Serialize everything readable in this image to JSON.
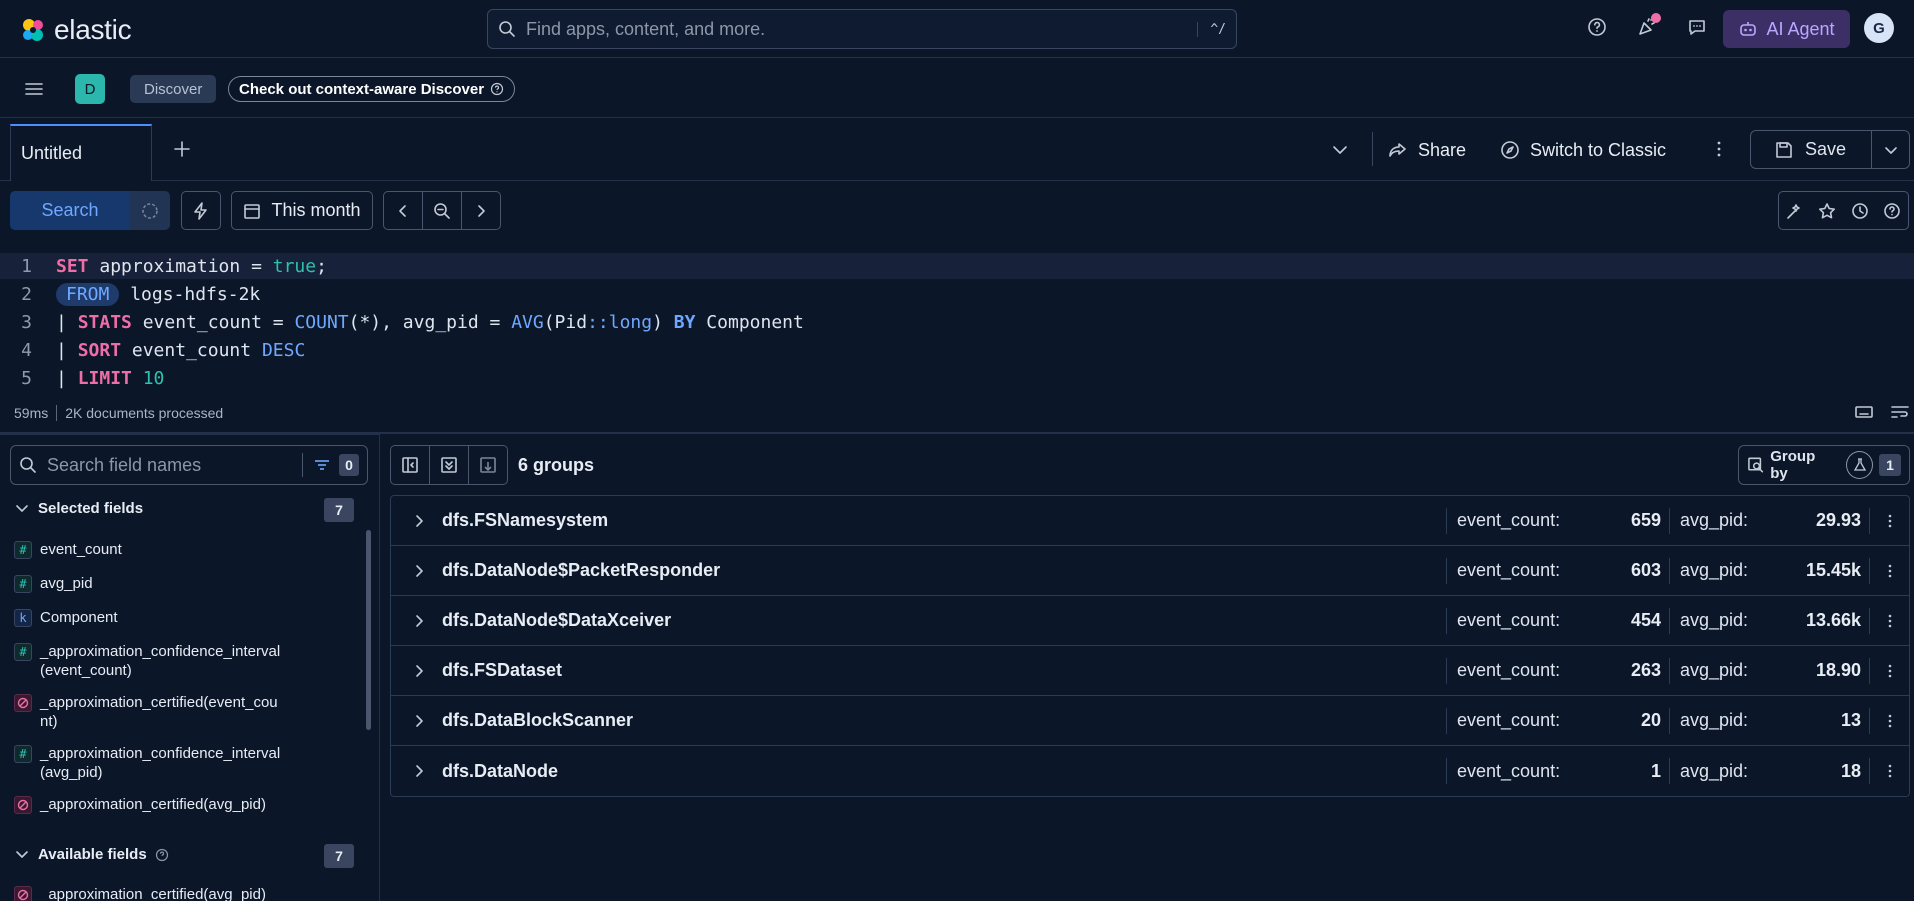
{
  "app": {
    "brand": "elastic"
  },
  "global_search": {
    "placeholder": "Find apps, content, and more.",
    "shortcut": "^/"
  },
  "header": {
    "ai_agent_label": "AI Agent",
    "avatar_initial": "G"
  },
  "breadcrumb": {
    "space_initial": "D",
    "current": "Discover",
    "context_link": "Check out context-aware Discover"
  },
  "tabs": [
    {
      "label": "Untitled"
    }
  ],
  "toolbar": {
    "share": "Share",
    "switch_classic": "Switch to Classic",
    "save": "Save"
  },
  "query": {
    "search_button": "Search",
    "time_range": "This month",
    "lines": [
      {
        "num": "1",
        "tokens": [
          {
            "t": "SET",
            "c": "kw-pink"
          },
          {
            "t": " approximation = ",
            "c": "plain"
          },
          {
            "t": "true",
            "c": "val"
          },
          {
            "t": ";",
            "c": "plain"
          }
        ]
      },
      {
        "num": "2",
        "tokens": [
          {
            "t": "FROM",
            "c": "from-pill"
          },
          {
            "t": " logs-hdfs-2k",
            "c": "plain"
          }
        ]
      },
      {
        "num": "3",
        "tokens": [
          {
            "t": "| ",
            "c": "plain"
          },
          {
            "t": "STATS",
            "c": "kw-pink"
          },
          {
            "t": " event_count = ",
            "c": "plain"
          },
          {
            "t": "COUNT",
            "c": "fn"
          },
          {
            "t": "(*), avg_pid = ",
            "c": "plain"
          },
          {
            "t": "AVG",
            "c": "fn"
          },
          {
            "t": "(Pid",
            "c": "plain"
          },
          {
            "t": "::long",
            "c": "fn"
          },
          {
            "t": ") ",
            "c": "plain"
          },
          {
            "t": "BY",
            "c": "kw-blue"
          },
          {
            "t": " Component",
            "c": "plain"
          }
        ]
      },
      {
        "num": "4",
        "tokens": [
          {
            "t": "| ",
            "c": "plain"
          },
          {
            "t": "SORT",
            "c": "kw-pink"
          },
          {
            "t": " event_count ",
            "c": "plain"
          },
          {
            "t": "DESC",
            "c": "fn"
          }
        ]
      },
      {
        "num": "5",
        "tokens": [
          {
            "t": "| ",
            "c": "plain"
          },
          {
            "t": "LIMIT",
            "c": "kw-pink"
          },
          {
            "t": " ",
            "c": "plain"
          },
          {
            "t": "10",
            "c": "val"
          }
        ]
      }
    ],
    "status_time": "59ms",
    "status_docs": "2K documents processed"
  },
  "sidebar": {
    "search_placeholder": "Search field names",
    "filter_count": "0",
    "selected_title": "Selected fields",
    "selected_count": "7",
    "selected_fields": [
      {
        "name": "event_count",
        "type": "#",
        "kind": "num"
      },
      {
        "name": "avg_pid",
        "type": "#",
        "kind": "num"
      },
      {
        "name": "Component",
        "type": "k",
        "kind": "kw"
      },
      {
        "name": "_approximation_confidence_interval\n(event_count)",
        "type": "#",
        "kind": "num"
      },
      {
        "name": "_approximation_certified(event_cou\nnt)",
        "type": "",
        "kind": "bool"
      },
      {
        "name": "_approximation_confidence_interval\n(avg_pid)",
        "type": "#",
        "kind": "num"
      },
      {
        "name": "_approximation_certified(avg_pid)",
        "type": "",
        "kind": "bool"
      }
    ],
    "available_title": "Available fields",
    "available_count": "7",
    "available_fields": [
      {
        "name": "_approximation_certified(avg_pid)",
        "type": "",
        "kind": "bool"
      }
    ]
  },
  "grid": {
    "groups_label": "6 groups",
    "group_by_label": "Group by",
    "group_by_count": "1",
    "col1_label": "event_count:",
    "col2_label": "avg_pid:",
    "rows": [
      {
        "name": "dfs.FSNamesystem",
        "event_count": "659",
        "avg_pid": "29.93"
      },
      {
        "name": "dfs.DataNode$PacketResponder",
        "event_count": "603",
        "avg_pid": "15.45k"
      },
      {
        "name": "dfs.DataNode$DataXceiver",
        "event_count": "454",
        "avg_pid": "13.66k"
      },
      {
        "name": "dfs.FSDataset",
        "event_count": "263",
        "avg_pid": "18.90"
      },
      {
        "name": "dfs.DataBlockScanner",
        "event_count": "20",
        "avg_pid": "13"
      },
      {
        "name": "dfs.DataNode",
        "event_count": "1",
        "avg_pid": "18"
      }
    ]
  }
}
